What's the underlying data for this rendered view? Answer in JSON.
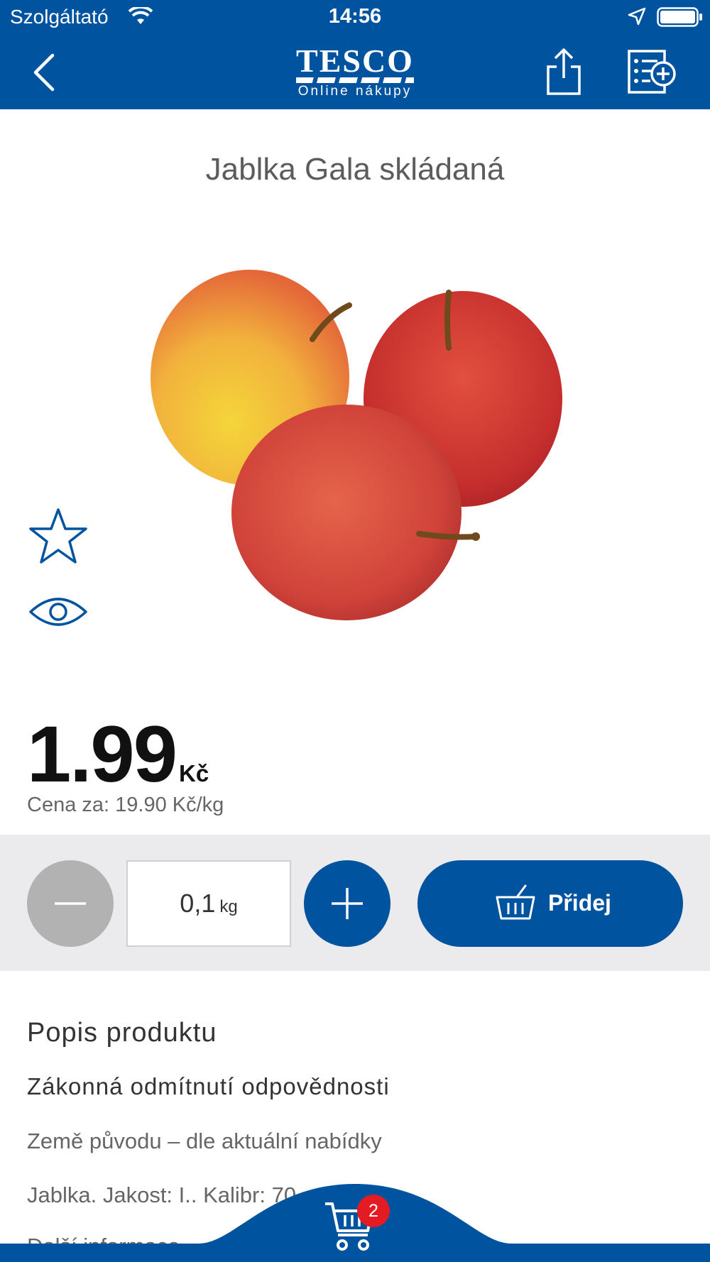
{
  "status_bar": {
    "carrier": "Szolgáltató",
    "time": "14:56"
  },
  "header": {
    "logo_text": "TESCO",
    "logo_subtitle": "Online nákupy"
  },
  "product": {
    "title": "Jablka Gala skládaná",
    "price": "1.99",
    "currency": "Kč",
    "unit_price": "Cena za: 19.90 Kč/kg"
  },
  "quantity": {
    "value": "0,1",
    "unit": "kg",
    "add_label": "Přidej"
  },
  "description": {
    "heading": "Popis produktu",
    "subheading": "Zákonná odmítnutí odpovědnosti",
    "line1": "Země původu – dle aktuální nabídky",
    "line2": "Jablka. Jakost: I.. Kalibr: 70",
    "line3": "Další informace"
  },
  "cart": {
    "badge_count": "2"
  },
  "colors": {
    "brand_blue": "#00539f",
    "badge_red": "#e41b23",
    "disabled_gray": "#b2b2b2"
  },
  "icons": [
    "back-chevron",
    "share",
    "add-to-list",
    "star",
    "eye",
    "basket",
    "cart",
    "wifi",
    "location-arrow",
    "battery"
  ]
}
